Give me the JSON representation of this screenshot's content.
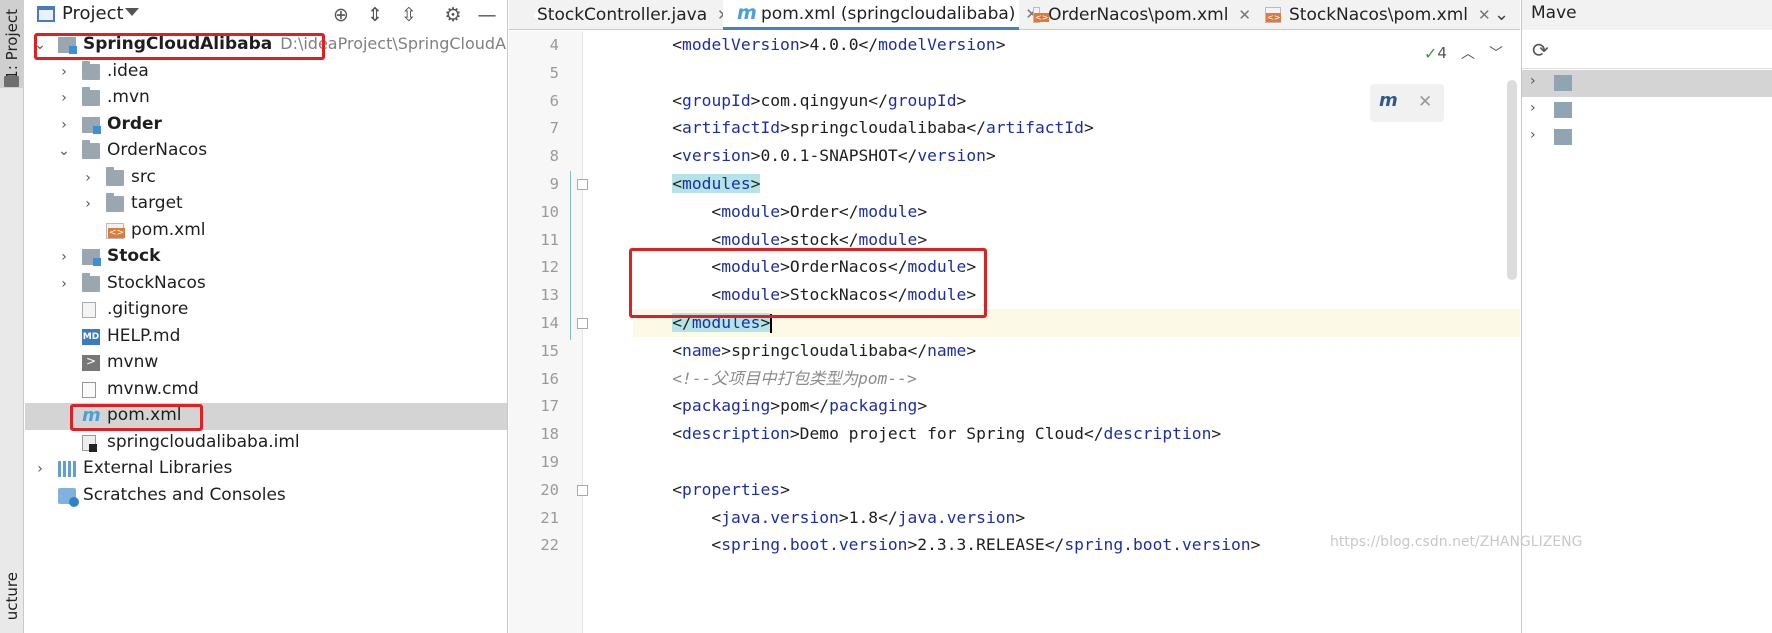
{
  "left_strip": {
    "project_tab": "1: Project",
    "structure_tab": "ucture"
  },
  "project_panel": {
    "title": "Project",
    "tree": [
      {
        "label": "SpringCloudAlibaba",
        "path": "D:\\ideaProject\\SpringCloudAlibab",
        "bold": true,
        "icon": "module-icon",
        "depth": 0,
        "expanded": true
      },
      {
        "label": ".idea",
        "icon": "folder-icon",
        "depth": 1,
        "expanded": false
      },
      {
        "label": ".mvn",
        "icon": "folder-icon",
        "depth": 1,
        "expanded": false
      },
      {
        "label": "Order",
        "bold": true,
        "icon": "module-icon",
        "depth": 1,
        "expanded": false
      },
      {
        "label": "OrderNacos",
        "icon": "folder-icon",
        "depth": 1,
        "expanded": true
      },
      {
        "label": "src",
        "icon": "folder-icon",
        "depth": 2,
        "expanded": false
      },
      {
        "label": "target",
        "icon": "folder-icon",
        "depth": 2,
        "expanded": false
      },
      {
        "label": "pom.xml",
        "icon": "xml-file-icon",
        "depth": 2,
        "leaf": true
      },
      {
        "label": "Stock",
        "bold": true,
        "icon": "module-icon",
        "depth": 1,
        "expanded": false
      },
      {
        "label": "StockNacos",
        "icon": "folder-icon",
        "depth": 1,
        "expanded": false
      },
      {
        "label": ".gitignore",
        "icon": "gitignore-file-icon",
        "depth": 1,
        "leaf": true
      },
      {
        "label": "HELP.md",
        "icon": "markdown-file-icon",
        "depth": 1,
        "leaf": true
      },
      {
        "label": "mvnw",
        "icon": "terminal-file-icon",
        "depth": 1,
        "leaf": true
      },
      {
        "label": "mvnw.cmd",
        "icon": "cmd-file-icon",
        "depth": 1,
        "leaf": true
      },
      {
        "label": "pom.xml",
        "icon": "maven-pom-icon",
        "depth": 1,
        "leaf": true,
        "selected": true
      },
      {
        "label": "springcloudalibaba.iml",
        "icon": "iml-file-icon",
        "depth": 1,
        "leaf": true
      },
      {
        "label": "External Libraries",
        "icon": "libraries-icon",
        "depth": 0,
        "expanded": false
      },
      {
        "label": "Scratches and Consoles",
        "icon": "scratches-icon",
        "depth": 0,
        "leaf": true
      }
    ]
  },
  "editor": {
    "tabs": [
      {
        "label": "StockController.java",
        "icon": "java-class-icon",
        "active": false
      },
      {
        "label": "pom.xml (springcloudalibaba)",
        "icon": "maven-pom-icon",
        "active": true
      },
      {
        "label": "OrderNacos\\pom.xml",
        "icon": "xml-file-icon",
        "active": false
      },
      {
        "label": "StockNacos\\pom.xml",
        "icon": "xml-file-icon",
        "active": false
      }
    ],
    "inspection_count": "4",
    "maven_popup_label": "m",
    "lines": [
      {
        "num": "4",
        "text": "    <modelVersion>4.0.0</modelVersion>"
      },
      {
        "num": "5",
        "text": ""
      },
      {
        "num": "6",
        "text": "    <groupId>com.qingyun</groupId>"
      },
      {
        "num": "7",
        "text": "    <artifactId>springcloudalibaba</artifactId>"
      },
      {
        "num": "8",
        "text": "    <version>0.0.1-SNAPSHOT</version>"
      },
      {
        "num": "9",
        "text": "    <modules>"
      },
      {
        "num": "10",
        "text": "        <module>Order</module>"
      },
      {
        "num": "11",
        "text": "        <module>stock</module>"
      },
      {
        "num": "12",
        "text": "        <module>OrderNacos</module>"
      },
      {
        "num": "13",
        "text": "        <module>StockNacos</module>"
      },
      {
        "num": "14",
        "text": "    </modules>"
      },
      {
        "num": "15",
        "text": "    <name>springcloudalibaba</name>"
      },
      {
        "num": "16",
        "text": "    <!--父项目中打包类型为pom-->"
      },
      {
        "num": "17",
        "text": "    <packaging>pom</packaging>"
      },
      {
        "num": "18",
        "text": "    <description>Demo project for Spring Cloud</description>"
      },
      {
        "num": "19",
        "text": ""
      },
      {
        "num": "20",
        "text": "    <properties>"
      },
      {
        "num": "21",
        "text": "        <java.version>1.8</java.version>"
      },
      {
        "num": "22",
        "text": "        <spring.boot.version>2.3.3.RELEASE</spring.boot.version>"
      }
    ]
  },
  "right_panel": {
    "title": "Mave"
  },
  "watermark": "https://blog.csdn.net/ZHANGLIZENG",
  "colors": {
    "accent": "#4083c9",
    "highlight_box": "#e02020",
    "tag": "#1d2ea4",
    "current_line": "#fcfae6"
  }
}
